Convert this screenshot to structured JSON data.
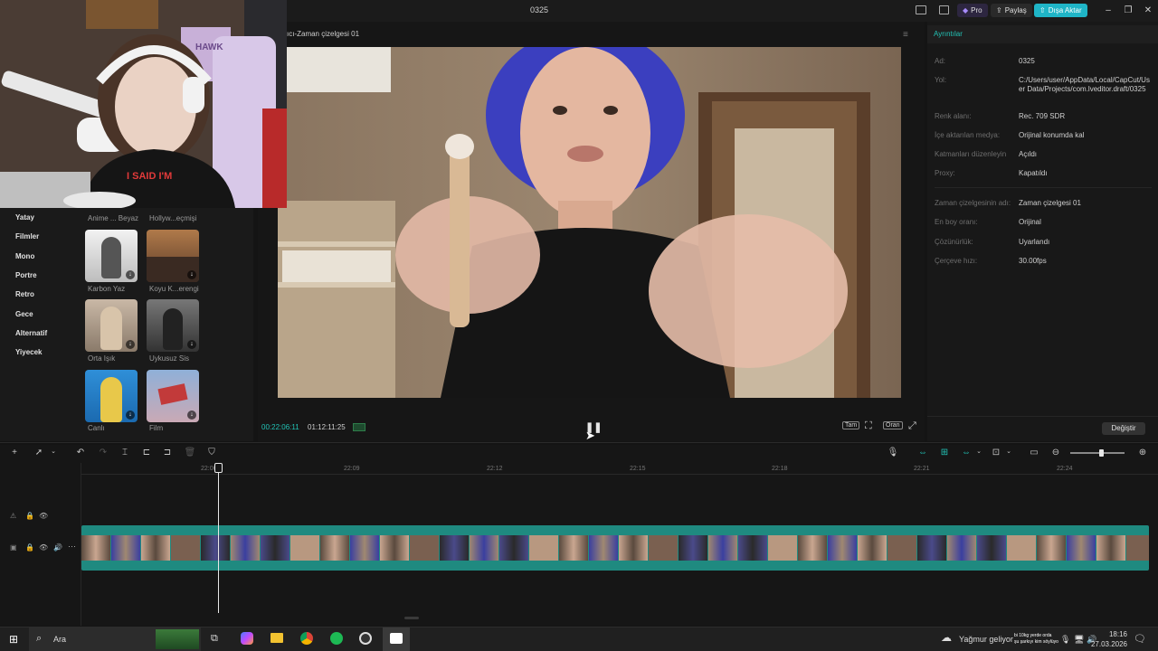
{
  "app": {
    "title": "0325",
    "pro_label": "Pro",
    "share_label": "Paylaş",
    "export_label": "Dışa Aktar",
    "accent_color": "#22c3b6",
    "export_color": "#1fb5c7"
  },
  "webcam": {
    "shirt_text": "I SAID I'M",
    "poster_text": "HAWK"
  },
  "filters": {
    "categories": [
      "Yatay",
      "Filmler",
      "Mono",
      "Portre",
      "Retro",
      "Gece",
      "Alternatif",
      "Yiyecek"
    ],
    "top_row_labels": [
      "Anime ... Beyaz",
      "Hollyw...eçmişi"
    ],
    "items": [
      {
        "label": "Karbon Yaz",
        "icon": "download-icon"
      },
      {
        "label": "Koyu K...erengi",
        "icon": "download-icon"
      },
      {
        "label": "Orta Işık",
        "icon": "download-icon"
      },
      {
        "label": "Uykusuz Sis",
        "icon": "download-icon"
      },
      {
        "label": "Canlı",
        "icon": "download-icon"
      },
      {
        "label": "Film",
        "icon": "download-icon"
      }
    ]
  },
  "player": {
    "header_title": "ıcı-Zaman çizelgesi 01",
    "current_time": "00:22:06:11",
    "total_time": "01:12:11:25",
    "full_label": "Tam",
    "ratio_label": "Oran"
  },
  "details": {
    "header": "Ayrıntılar",
    "rows": [
      {
        "label": "Ad:",
        "value": "0325"
      },
      {
        "label": "Yol:",
        "value": "C:/Users/user/AppData/Local/CapCut/User Data/Projects/com.lveditor.draft/0325"
      },
      {
        "label": "Renk alanı:",
        "value": "Rec. 709 SDR"
      },
      {
        "label": "İçe aktarılan medya:",
        "value": "Orijinal konumda kal"
      },
      {
        "label": "Katmanları düzenleyin",
        "value": "Açıldı"
      },
      {
        "label": "Proxy:",
        "value": "Kapatıldı"
      },
      {
        "label": "Zaman çizelgesinin adı:",
        "value": "Zaman çizelgesi 01"
      },
      {
        "label": "En boy oranı:",
        "value": "Orijinal"
      },
      {
        "label": "Çözünürlük:",
        "value": "Uyarlandı"
      },
      {
        "label": "Çerçeve hızı:",
        "value": "30.00fps"
      }
    ],
    "change_label": "Değiştir"
  },
  "timeline": {
    "ruler_labels": [
      "22:06",
      "22:09",
      "22:12",
      "22:15",
      "22:18",
      "22:21",
      "22:24"
    ],
    "clip_color": "#1f8a80",
    "playhead_position": "22:06"
  },
  "taskbar": {
    "search_label": "Ara",
    "weather_text": "Yağmur geliyor",
    "notification_line1": "bi 10kg yerde orda",
    "notification_line2": "şu şarkıyı kim söylüyo",
    "time": "18:16",
    "date": "27.03.2026"
  }
}
